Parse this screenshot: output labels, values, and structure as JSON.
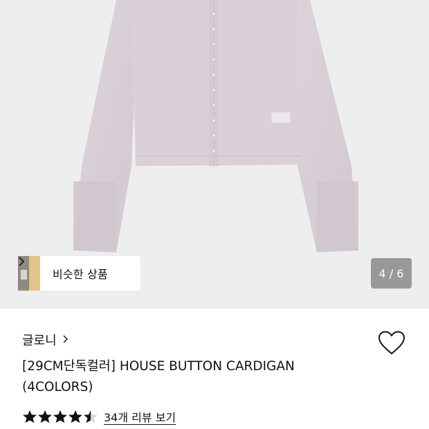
{
  "product_image": {
    "alt": "cardigan"
  },
  "similar_products": {
    "label": "비슷한 상품"
  },
  "pager": {
    "text": "4 / 6"
  },
  "brand": {
    "name": "글로니"
  },
  "product": {
    "title": "[29CM단독컬러] HOUSE BUTTON CARDIGAN (4COLORS)"
  },
  "rating": {
    "value": 4.5,
    "max": 5,
    "reviews_link": "34개 리뷰 보기"
  },
  "icons": {
    "brand_chevron": "chevron-right-icon",
    "heart": "heart-icon",
    "similar_chevron": "chevron-right-icon"
  },
  "colors": {
    "hero_bg": "#efeeee",
    "cardigan": "#d8cfd6",
    "pager_bg": "#828282"
  }
}
